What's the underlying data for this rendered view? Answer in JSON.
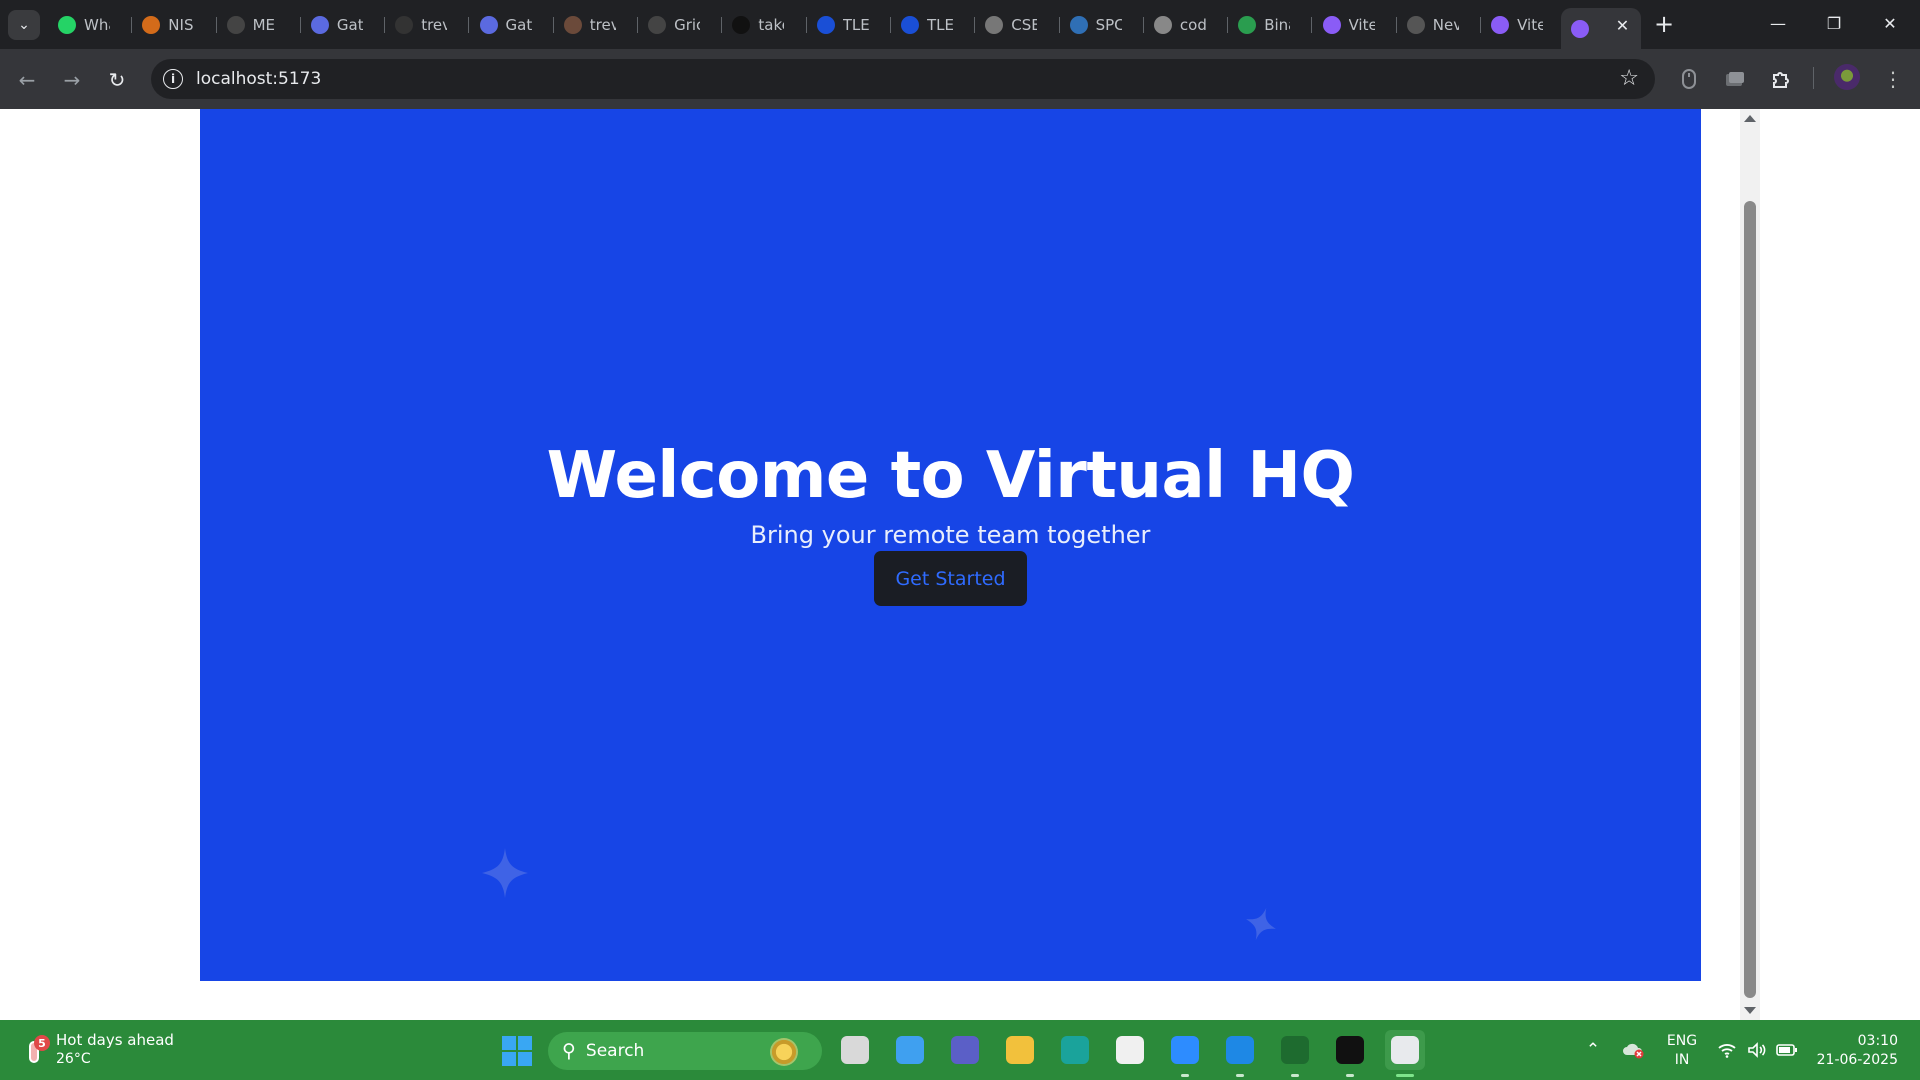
{
  "browser": {
    "tabs": [
      {
        "title": "Wha",
        "icon": "whatsapp-icon",
        "color": "#25d366"
      },
      {
        "title": "NIS",
        "icon": "nist-icon",
        "color": "#d36b1a"
      },
      {
        "title": "ME",
        "icon": "openai-icon",
        "color": "#444444"
      },
      {
        "title": "Gat",
        "icon": "gatsby-icon",
        "color": "#5b6ae0"
      },
      {
        "title": "trev",
        "icon": "github-icon",
        "color": "#333333"
      },
      {
        "title": "Gat",
        "icon": "gatsby-icon",
        "color": "#5b6ae0"
      },
      {
        "title": "trev",
        "icon": "profile-icon",
        "color": "#6b4a3a"
      },
      {
        "title": "Gric",
        "icon": "openai-icon",
        "color": "#444444"
      },
      {
        "title": "take",
        "icon": "tuf-icon",
        "color": "#111111"
      },
      {
        "title": "TLE",
        "icon": "tle-icon",
        "color": "#1a4fd6"
      },
      {
        "title": "TLE",
        "icon": "tle-icon",
        "color": "#1a4fd6"
      },
      {
        "title": "CSE",
        "icon": "globe-icon",
        "color": "#777777"
      },
      {
        "title": "SPC",
        "icon": "spc-icon",
        "color": "#2f6fb5"
      },
      {
        "title": "cod",
        "icon": "chart-icon",
        "color": "#888888"
      },
      {
        "title": "Bina",
        "icon": "drive-icon",
        "color": "#2a9d4f"
      },
      {
        "title": "Vite",
        "icon": "vite-icon",
        "color": "#8a5cf6"
      },
      {
        "title": "Nev",
        "icon": "chrome-icon",
        "color": "#555555"
      },
      {
        "title": "Vite",
        "icon": "vite-icon",
        "color": "#8a5cf6"
      },
      {
        "title": "",
        "icon": "vite-icon",
        "color": "#8a5cf6",
        "active": true
      }
    ],
    "url": "localhost:5173"
  },
  "page": {
    "title": "Welcome to Virtual HQ",
    "subtitle": "Bring your remote team together",
    "cta_label": "Get Started",
    "hero_color": "#1745e6",
    "cta_text_color": "#2f6bff"
  },
  "taskbar": {
    "weather": {
      "badge": "5",
      "headline": "Hot days ahead",
      "temp": "26°C"
    },
    "search_label": "Search",
    "lang_line1": "ENG",
    "lang_line2": "IN",
    "time": "03:10",
    "date": "21-06-2025",
    "apps": [
      {
        "name": "task-view",
        "icon": "task-view-icon",
        "color": "#d9d9d9"
      },
      {
        "name": "copilot",
        "icon": "copilot-icon",
        "color": "#3fa0f0"
      },
      {
        "name": "teams",
        "icon": "teams-icon",
        "color": "#5b5fc7"
      },
      {
        "name": "file-explorer",
        "icon": "folder-icon",
        "color": "#f2c13c"
      },
      {
        "name": "edge",
        "icon": "edge-icon",
        "color": "#1aa39b"
      },
      {
        "name": "store",
        "icon": "store-icon",
        "color": "#f0f0f0"
      },
      {
        "name": "zoom",
        "icon": "zoom-icon",
        "color": "#2d8cff"
      },
      {
        "name": "vscode",
        "icon": "vscode-icon",
        "color": "#1e88e5"
      },
      {
        "name": "mongodb",
        "icon": "mongodb-icon",
        "color": "#1e6b2f"
      },
      {
        "name": "cursor",
        "icon": "cursor-icon",
        "color": "#111111"
      },
      {
        "name": "chrome",
        "icon": "chrome-icon",
        "color": "#e8eaed",
        "active": true
      }
    ]
  }
}
